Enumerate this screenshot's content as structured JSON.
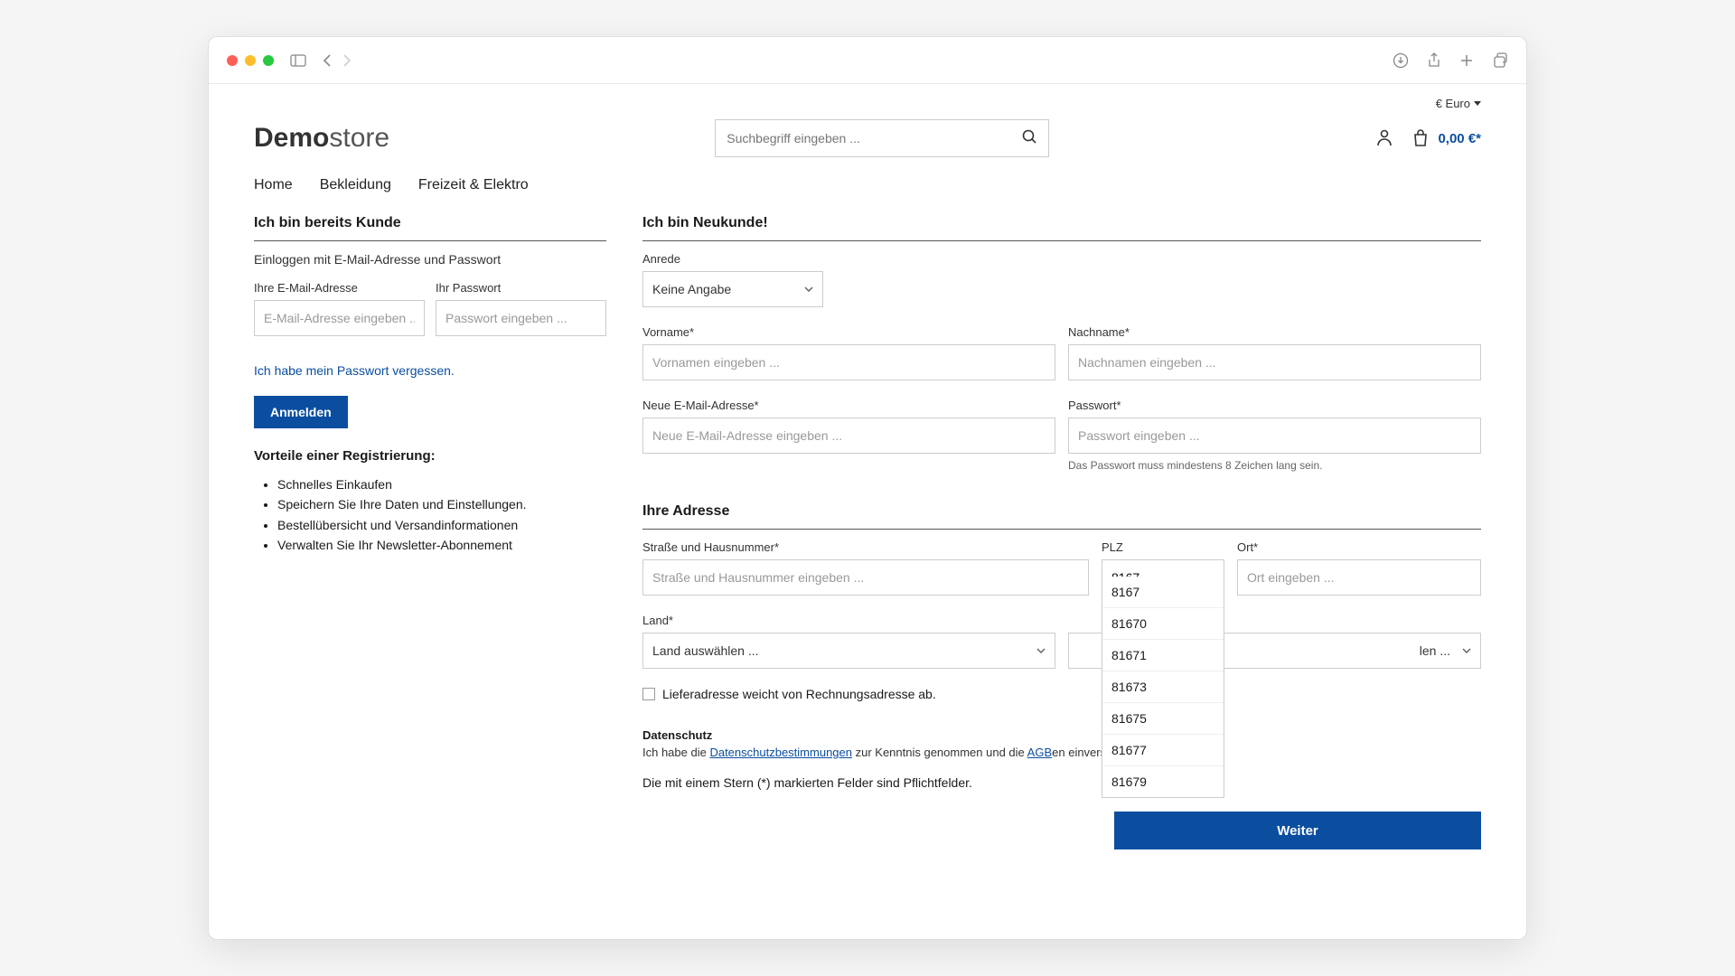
{
  "currency": "€ Euro",
  "logo_bold": "Demo",
  "logo_rest": "store",
  "search_placeholder": "Suchbegriff eingeben ...",
  "cart_amount": "0,00 €*",
  "nav": {
    "home": "Home",
    "bekleidung": "Bekleidung",
    "freizeit": "Freizeit & Elektro"
  },
  "login": {
    "title": "Ich bin bereits Kunde",
    "subtitle": "Einloggen mit E-Mail-Adresse und Passwort",
    "email_label": "Ihre E-Mail-Adresse",
    "email_placeholder": "E-Mail-Adresse eingeben ...",
    "password_label": "Ihr Passwort",
    "password_placeholder": "Passwort eingeben ...",
    "forgot": "Ich habe mein Passwort vergessen.",
    "submit": "Anmelden",
    "benefits_title": "Vorteile einer Registrierung:",
    "benefits": [
      "Schnelles Einkaufen",
      "Speichern Sie Ihre Daten und Einstellungen.",
      "Bestellübersicht und Versandinformationen",
      "Verwalten Sie Ihr Newsletter-Abonnement"
    ]
  },
  "register": {
    "title": "Ich bin Neukunde!",
    "anrede_label": "Anrede",
    "anrede_value": "Keine Angabe",
    "vorname_label": "Vorname*",
    "vorname_placeholder": "Vornamen eingeben ...",
    "nachname_label": "Nachname*",
    "nachname_placeholder": "Nachnamen eingeben ...",
    "email_label": "Neue E-Mail-Adresse*",
    "email_placeholder": "Neue E-Mail-Adresse eingeben ...",
    "password_label": "Passwort*",
    "password_placeholder": "Passwort eingeben ...",
    "password_hint": "Das Passwort muss mindestens 8 Zeichen lang sein.",
    "address_title": "Ihre Adresse",
    "street_label": "Straße und Hausnummer*",
    "street_placeholder": "Straße und Hausnummer eingeben ...",
    "plz_label": "PLZ",
    "plz_value": "8167",
    "plz_options": [
      "8167",
      "81670",
      "81671",
      "81673",
      "81675",
      "81677",
      "81679"
    ],
    "ort_label": "Ort*",
    "ort_placeholder": "Ort eingeben ...",
    "land_label": "Land*",
    "land_value": "Land auswählen ...",
    "bundesland_value": "len ...",
    "shipping_diff": "Lieferadresse weicht von Rechnungsadresse ab.",
    "privacy_heading": "Datenschutz",
    "privacy_prefix": "Ich habe die ",
    "privacy_link": "Datenschutzbestimmungen",
    "privacy_mid": " zur Kenntnis genommen und die ",
    "agb_link": "AGB",
    "privacy_suffix": "en einverstanden.",
    "required_note": "Die mit einem Stern (*) markierten Felder sind Pflichtfelder.",
    "continue": "Weiter"
  }
}
